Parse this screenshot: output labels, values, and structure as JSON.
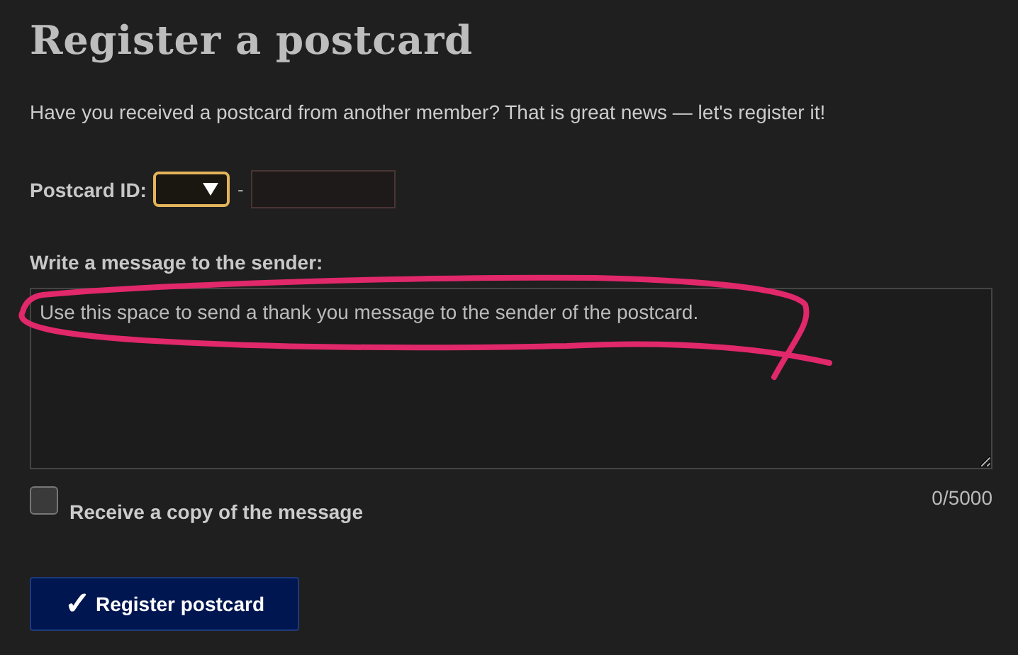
{
  "title": "Register a postcard",
  "intro": "Have you received a postcard from another member? That is great news — let's register it!",
  "postcard_id": {
    "label": "Postcard ID:",
    "separator": "-"
  },
  "message": {
    "label": "Write a message to the sender:",
    "placeholder": "Use this space to send a thank you message to the sender of the postcard.",
    "counter": "0/5000"
  },
  "copy_checkbox": {
    "label": "Receive a copy of the message",
    "checked": false
  },
  "submit": {
    "icon": "✓",
    "label": "Register postcard"
  }
}
